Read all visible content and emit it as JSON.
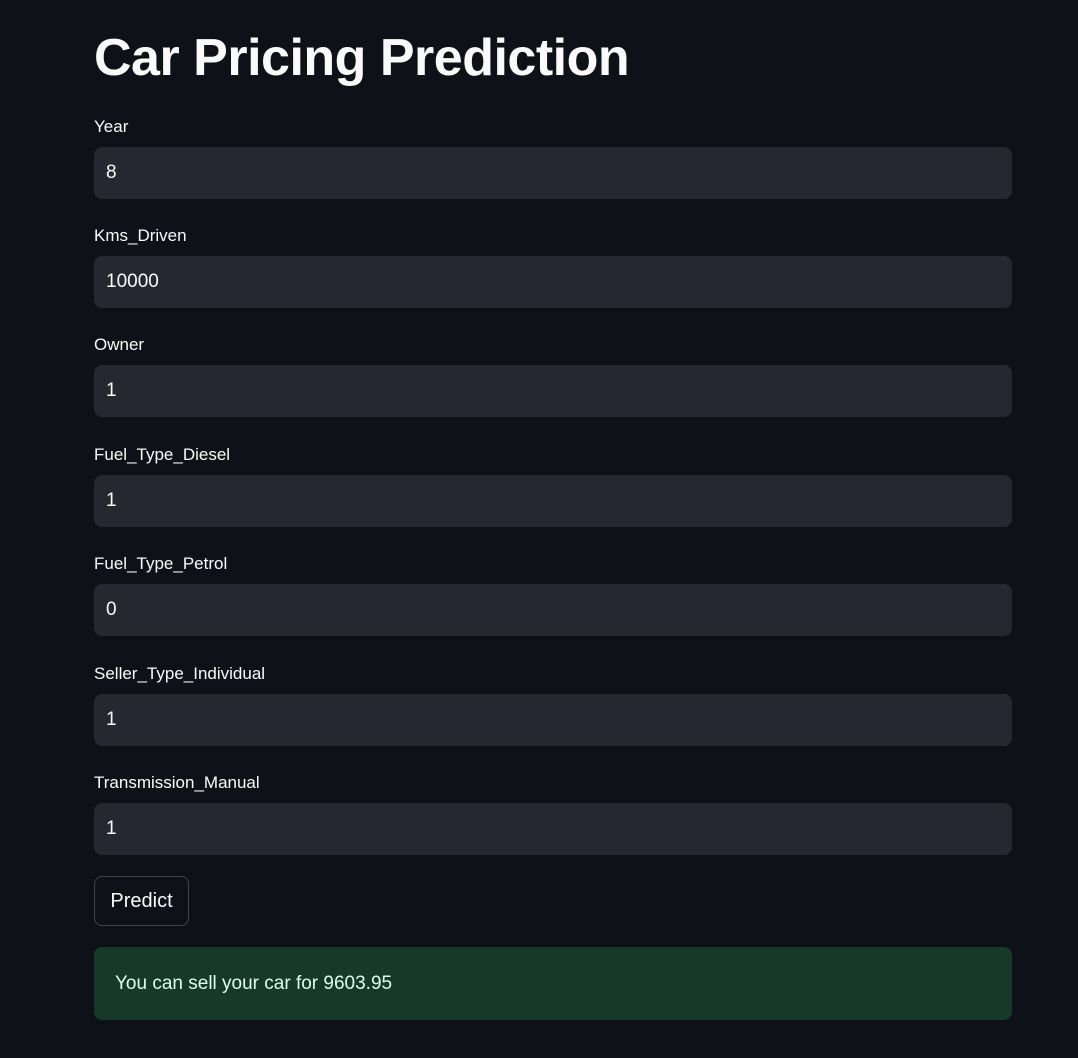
{
  "page": {
    "title": "Car Pricing Prediction"
  },
  "form": {
    "fields": [
      {
        "label": "Year",
        "value": "8"
      },
      {
        "label": "Kms_Driven",
        "value": "10000"
      },
      {
        "label": "Owner",
        "value": "1"
      },
      {
        "label": "Fuel_Type_Diesel",
        "value": "1"
      },
      {
        "label": "Fuel_Type_Petrol",
        "value": "0"
      },
      {
        "label": "Seller_Type_Individual",
        "value": "1"
      },
      {
        "label": "Transmission_Manual",
        "value": "1"
      }
    ],
    "predict_label": "Predict"
  },
  "result": {
    "message": "You can sell your car for 9603.95"
  },
  "colors": {
    "background": "#0e1117",
    "input_background": "#262730",
    "success_background": "#173928",
    "text": "#fafafa"
  }
}
